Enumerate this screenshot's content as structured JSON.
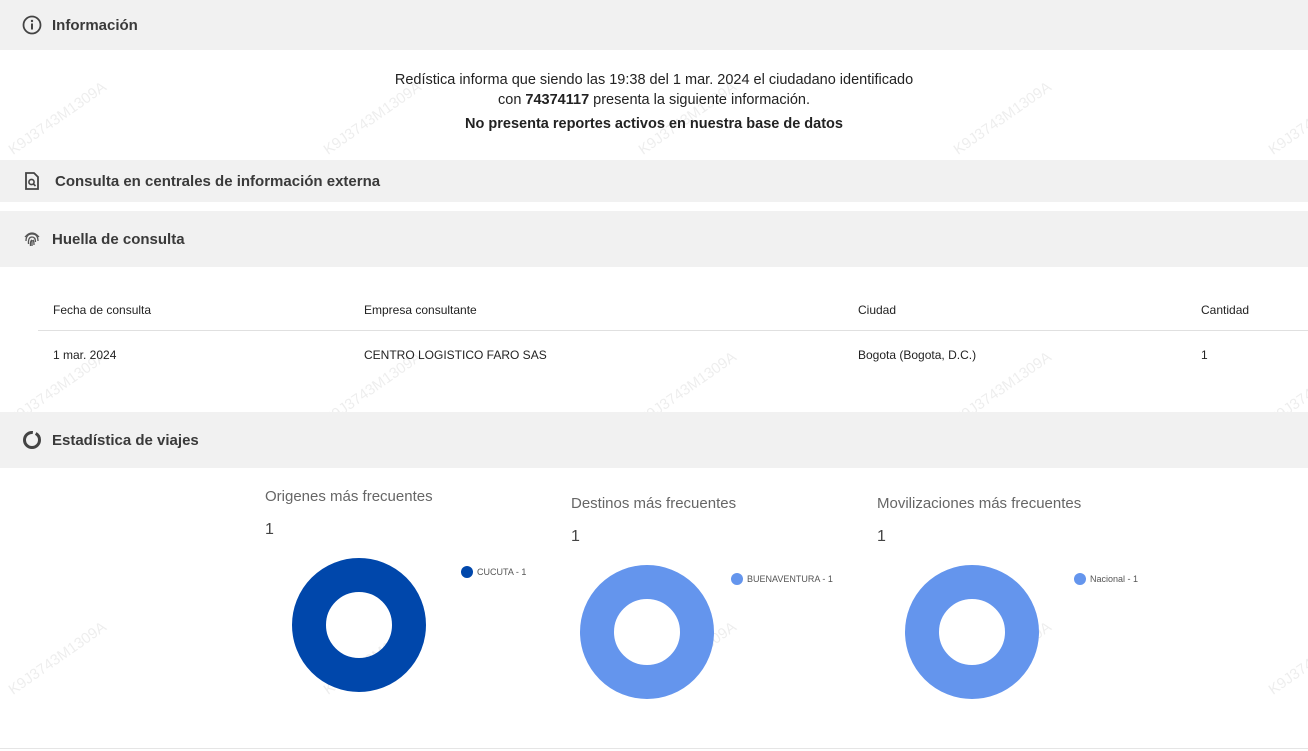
{
  "sections": {
    "info": {
      "title": "Información",
      "icon": "info-circle-icon"
    },
    "external": {
      "title": "Consulta en centrales de información externa",
      "icon": "document-search-icon"
    },
    "huella": {
      "title": "Huella de consulta",
      "icon": "fingerprint-icon"
    },
    "stats": {
      "title": "Estadística de viajes",
      "icon": "donut-chart-icon"
    }
  },
  "info": {
    "line1": "Redística informa que siendo las 19:38 del 1 mar. 2024 el ciudadano identificado",
    "line2_pre": "con ",
    "id_number": "74374117",
    "line2_post": " presenta la siguiente información.",
    "no_reports": "No presenta reportes activos en nuestra base de datos"
  },
  "table": {
    "headers": [
      "Fecha de consulta",
      "Empresa consultante",
      "Ciudad",
      "Cantidad"
    ],
    "rows": [
      [
        "1 mar. 2024",
        "CENTRO LOGISTICO FARO SAS",
        "Bogota (Bogota, D.C.)",
        "1"
      ]
    ]
  },
  "charts": [
    {
      "title": "Origenes más frecuentes",
      "count": "1",
      "legend": "CUCUTA - 1",
      "color": "#0047ab"
    },
    {
      "title": "Destinos más frecuentes",
      "count": "1",
      "legend": "BUENAVENTURA - 1",
      "color": "#6495ed"
    },
    {
      "title": "Movilizaciones más frecuentes",
      "count": "1",
      "legend": "Nacional - 1",
      "color": "#6495ed"
    }
  ],
  "watermark": "K9J3743M1309A"
}
